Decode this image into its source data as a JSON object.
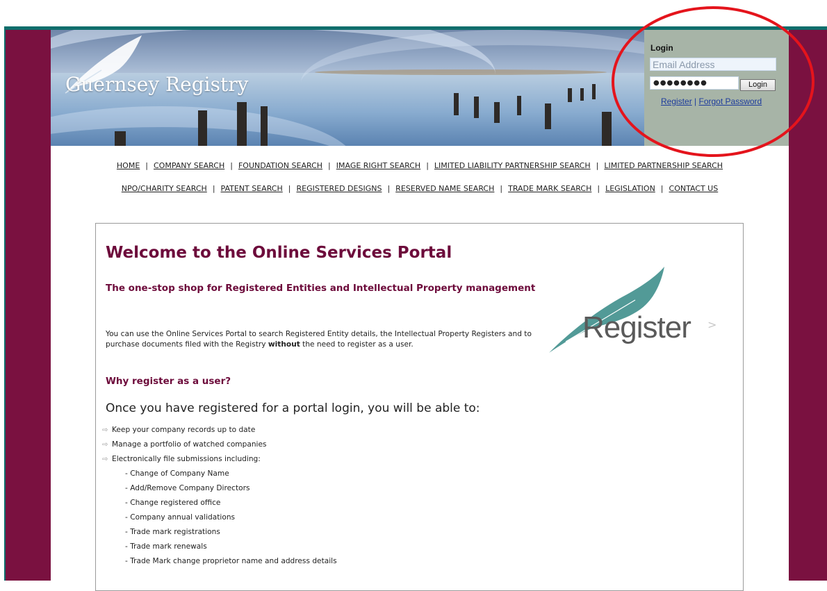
{
  "header": {
    "logo_text": "Guernsey Registry"
  },
  "login": {
    "title": "Login",
    "email_placeholder": "Email Address",
    "password_mask": "●●●●●●●●",
    "login_button": "Login",
    "register_link": "Register",
    "separator": "|",
    "forgot_link": "Forgot Password"
  },
  "nav": {
    "row1": [
      "HOME",
      "COMPANY SEARCH",
      "FOUNDATION SEARCH",
      "IMAGE RIGHT SEARCH",
      "LIMITED LIABILITY PARTNERSHIP SEARCH",
      "LIMITED PARTNERSHIP SEARCH"
    ],
    "row2": [
      "NPO/CHARITY SEARCH",
      "PATENT SEARCH",
      "REGISTERED DESIGNS",
      "RESERVED NAME SEARCH",
      "TRADE MARK SEARCH",
      "LEGISLATION",
      "CONTACT US"
    ]
  },
  "content": {
    "title": "Welcome to the Online Services Portal",
    "subtitle": "The one-stop shop for Registered Entities and Intellectual Property management",
    "intro_before": "You can use the Online Services Portal to search Registered Entity details, the Intellectual Property Registers and to purchase documents filed with the Registry ",
    "intro_bold": "without",
    "intro_after": " the need to register as a user.",
    "why_heading": "Why register as a user?",
    "once_text": "Once you have registered for a portal login, you will be able to:",
    "benefits": [
      "Keep your company records up to date",
      "Manage a portfolio of watched companies",
      "Electronically file submissions including:"
    ],
    "submissions": [
      "- Change of Company Name",
      "- Add/Remove Company Directors",
      "- Change registered office",
      "- Company annual validations",
      "- Trade mark registrations",
      "- Trade mark renewals",
      "- Trade Mark change proprietor name and address details"
    ],
    "register_logo_text": "Register"
  },
  "colors": {
    "frame": "#7a1140",
    "frame_border": "#0f6e6c",
    "heading": "#6d0b3b",
    "login_panel": "#a7b4a7",
    "link": "#1d3b9c",
    "annotation_ring": "#e4141c"
  }
}
